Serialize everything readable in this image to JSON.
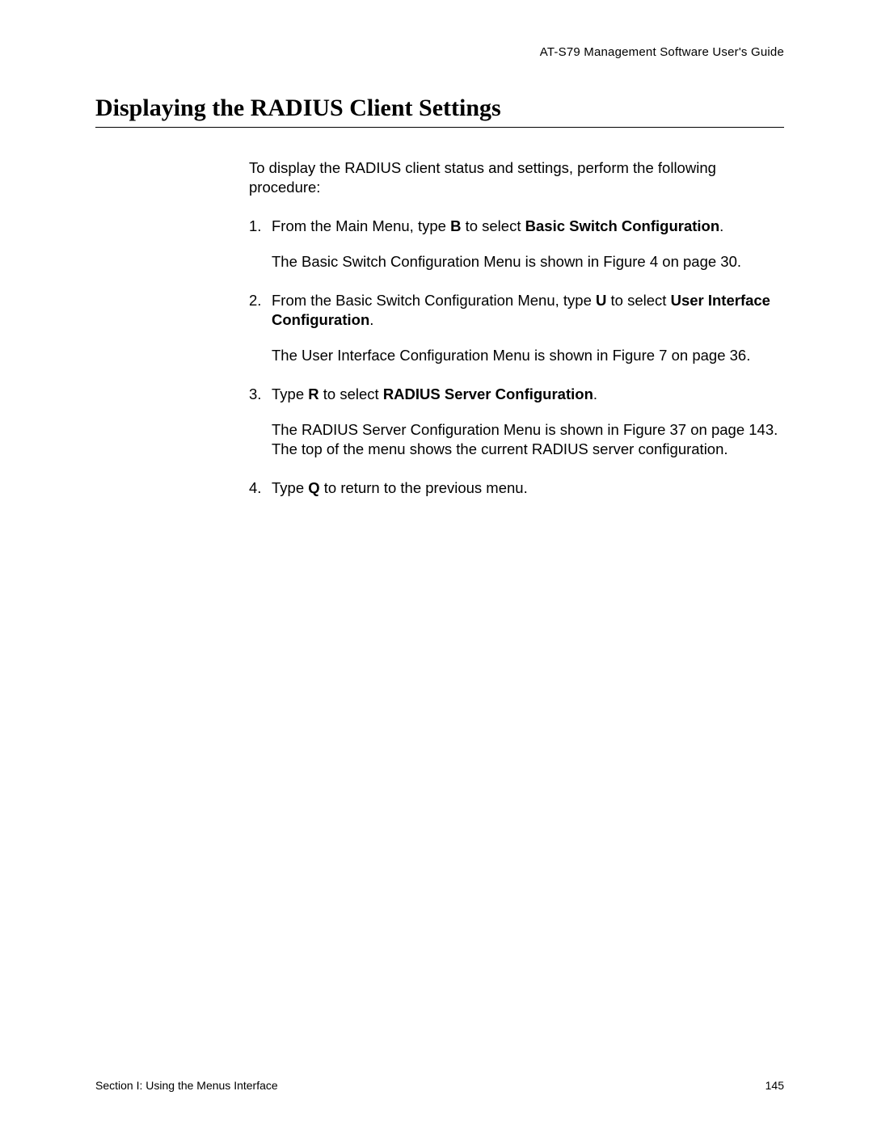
{
  "header": {
    "running": "AT-S79 Management Software User's Guide"
  },
  "title": "Displaying the RADIUS Client Settings",
  "intro": "To display the RADIUS client status and settings, perform the following procedure:",
  "steps": {
    "s1": {
      "num": "1.",
      "pre": "From the Main Menu, type ",
      "key": "B",
      "mid": " to select ",
      "bold": "Basic Switch Configuration",
      "post": ".",
      "follow": "The Basic Switch Configuration Menu is shown in Figure 4 on page 30."
    },
    "s2": {
      "num": "2.",
      "pre": "From the Basic Switch Configuration Menu, type ",
      "key": "U",
      "mid": " to select ",
      "bold": "User Interface Configuration",
      "post": ".",
      "follow": "The User Interface Configuration Menu is shown in Figure 7 on page 36."
    },
    "s3": {
      "num": "3.",
      "pre": "Type ",
      "key": "R",
      "mid": " to select ",
      "bold": "RADIUS Server Configuration",
      "post": ".",
      "follow": "The RADIUS Server Configuration Menu is shown in Figure 37 on page 143. The top of the menu shows the current RADIUS server configuration."
    },
    "s4": {
      "num": "4.",
      "pre": "Type ",
      "key": "Q",
      "mid": " to return to the previous menu.",
      "bold": "",
      "post": ""
    }
  },
  "footer": {
    "left": "Section I: Using the Menus Interface",
    "right": "145"
  }
}
